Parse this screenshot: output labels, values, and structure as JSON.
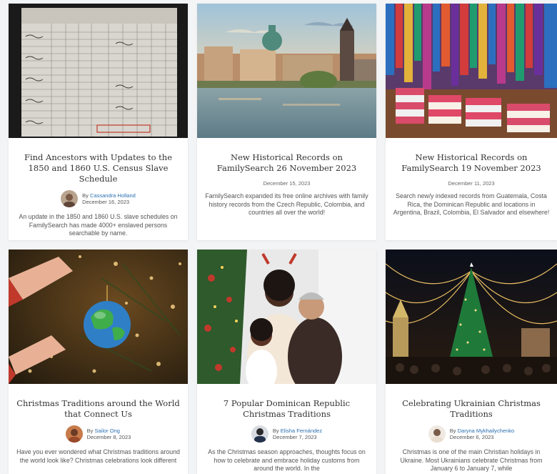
{
  "cards": [
    {
      "title": "Find Ancestors with Updates to the 1850 and 1860 U.S. Census Slave Schedule",
      "by_label": "By",
      "author": "Cassandra Holland",
      "date": "December 16, 2023",
      "excerpt": "An update in the 1850 and 1860 U.S. slave schedules on FamilySearch has made 4000+ enslaved persons searchable by name."
    },
    {
      "title": "New Historical Records on FamilySearch 26 November 2023",
      "date": "December 15, 2023",
      "excerpt": "FamilySearch expanded its free online archives with family history records from the Czech Republic, Colombia, and countries all over the world!"
    },
    {
      "title": "New Historical Records on FamilySearch 19 November 2023",
      "date": "December 11, 2023",
      "excerpt": "Search new/y indexed records from Guatemala, Costa Rica, the Dominican Republic and locations in Argentina, Brazil, Colombia, El Salvador and elsewhere!"
    },
    {
      "title": "Christmas Traditions around the World that Connect Us",
      "by_label": "By",
      "author": "Sailor Ong",
      "date": "December 8, 2023",
      "excerpt": "Have you ever wondered what Christmas traditions around the world look like? Christmas celebrations look different"
    },
    {
      "title": "7 Popular Dominican Republic Christmas Traditions",
      "by_label": "By",
      "author": "Elisha Fernández",
      "date": "December 7, 2023",
      "excerpt": "As the Christmas season approaches, thoughts focus on how to celebrate and embrace holiday customs from around the world. In the"
    },
    {
      "title": "Celebrating Ukrainian Christmas Traditions",
      "by_label": "By",
      "author": "Daryna Mykhailychenko",
      "date": "December 6, 2023",
      "excerpt": "Christmas is one of the main Christian holidays in Ukraine. Most Ukrainians celebrate Christmas from January 6 to January 7, while"
    }
  ],
  "colors": {
    "author_link": "#2a6fb0",
    "card_bg": "#ffffff",
    "page_bg": "#f3f4f6"
  }
}
